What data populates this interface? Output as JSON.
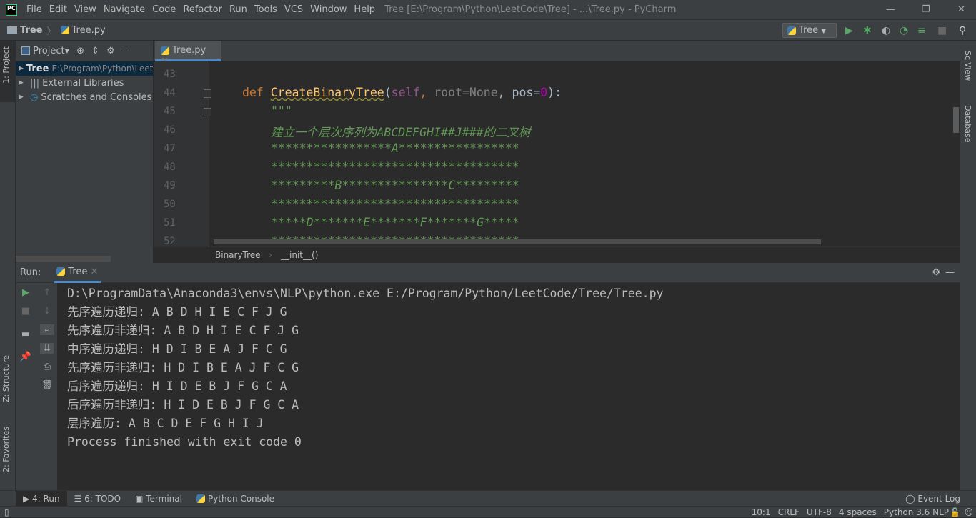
{
  "menubar": {
    "logo": "PC",
    "items": [
      "File",
      "Edit",
      "View",
      "Navigate",
      "Code",
      "Refactor",
      "Run",
      "Tools",
      "VCS",
      "Window",
      "Help"
    ],
    "window_title": "Tree [E:\\Program\\Python\\LeetCode\\Tree] - ...\\Tree.py - PyCharm"
  },
  "navbar": {
    "project": "Tree",
    "file": "Tree.py",
    "run_config": "Tree"
  },
  "left_stripe": {
    "project": "1: Project",
    "structure": "Z: Structure",
    "favorites": "2: Favorites"
  },
  "right_stripe": {
    "sciview": "SciView",
    "database": "Database"
  },
  "project_panel": {
    "title": "Project",
    "items": [
      {
        "label": "Tree",
        "path": "E:\\Program\\Python\\LeetCode\\Tree"
      },
      {
        "label": "External Libraries"
      },
      {
        "label": "Scratches and Consoles"
      }
    ]
  },
  "editor": {
    "tab": "Tree.py",
    "line_numbers": [
      "43",
      "44",
      "45",
      "46",
      "47",
      "48",
      "49",
      "50",
      "51",
      "52"
    ],
    "def_kw": "def",
    "fn_name": "CreateBinaryTree",
    "paren_open": "(",
    "self_kw": "self",
    "params1": ", ",
    "root_param": "root=None",
    "params2": ", pos=",
    "zero": "0",
    "paren_close": "):",
    "doc_lines": [
      "\"\"\"",
      "建立一个层次序列为ABCDEFGHI##J###的二叉树",
      "*****************A*****************",
      "***********************************",
      "*********B***************C*********",
      "***********************************",
      "*****D*******E*******F*******G*****",
      "***********************************"
    ],
    "breadcrumb": [
      "BinaryTree",
      "__init__()"
    ]
  },
  "run_panel": {
    "label": "Run:",
    "tab": "Tree",
    "output": [
      "D:\\ProgramData\\Anaconda3\\envs\\NLP\\python.exe E:/Program/Python/LeetCode/Tree/Tree.py",
      "先序遍历递归: A B D H I E C F J G",
      "先序遍历非递归: A B D H I E C F J G",
      "中序遍历递归: H D I B E A J F C G",
      "先序遍历非递归: H D I B E A J F C G",
      "后序遍历递归: H I D E B J F G C A",
      "后序遍历非递归: H I D E B J F G C A",
      "层序遍历: A B C D E F G H I J",
      "Process finished with exit code 0"
    ]
  },
  "bottom_tabs": [
    "4: Run",
    "6: TODO",
    "Terminal",
    "Python Console"
  ],
  "event_log": "Event Log",
  "status": {
    "position": "10:1",
    "line_sep": "CRLF",
    "encoding": "UTF-8",
    "indent": "4 spaces",
    "interpreter": "Python 3.6 NLP"
  }
}
